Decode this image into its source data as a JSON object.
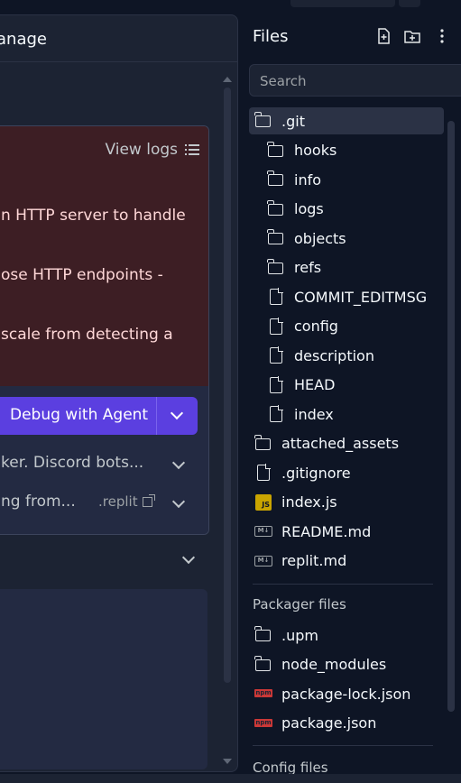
{
  "left_panel": {
    "title": "anage",
    "view_logs": "View logs",
    "error_lines": [
      "n HTTP server to handle",
      "ose HTTP endpoints -",
      "scale from detecting a"
    ],
    "debug_button": "Debug with Agent",
    "rows": [
      "ker. Discord bots...",
      "ng from..."
    ],
    "replit_link": ".replit"
  },
  "files_panel": {
    "title": "Files",
    "search_placeholder": "Search",
    "tree": [
      {
        "label": ".git",
        "type": "folder",
        "depth": 0,
        "selected": true
      },
      {
        "label": "hooks",
        "type": "folder",
        "depth": 1
      },
      {
        "label": "info",
        "type": "folder",
        "depth": 1
      },
      {
        "label": "logs",
        "type": "folder",
        "depth": 1
      },
      {
        "label": "objects",
        "type": "folder",
        "depth": 1
      },
      {
        "label": "refs",
        "type": "folder",
        "depth": 1
      },
      {
        "label": "COMMIT_EDITMSG",
        "type": "file",
        "depth": 1
      },
      {
        "label": "config",
        "type": "file",
        "depth": 1
      },
      {
        "label": "description",
        "type": "file",
        "depth": 1
      },
      {
        "label": "HEAD",
        "type": "file",
        "depth": 1
      },
      {
        "label": "index",
        "type": "file",
        "depth": 1
      },
      {
        "label": "attached_assets",
        "type": "folder",
        "depth": 0
      },
      {
        "label": ".gitignore",
        "type": "file",
        "depth": 0
      },
      {
        "label": "index.js",
        "type": "js",
        "depth": 0
      },
      {
        "label": "README.md",
        "type": "md",
        "depth": 0
      },
      {
        "label": "replit.md",
        "type": "md",
        "depth": 0
      }
    ],
    "packager_label": "Packager files",
    "packager": [
      {
        "label": ".upm",
        "type": "folder"
      },
      {
        "label": "node_modules",
        "type": "folder"
      },
      {
        "label": "package-lock.json",
        "type": "npm"
      },
      {
        "label": "package.json",
        "type": "npm"
      }
    ],
    "config_label": "Config files"
  },
  "icons": {
    "new_file": "new-file-icon",
    "new_folder": "new-folder-icon",
    "more": "more-vertical-icon",
    "js": "JS",
    "md": "M↓",
    "npm": "npm"
  },
  "colors": {
    "background": "#0e1525",
    "panel": "#1c2333",
    "accent": "#5b3fe0",
    "error_bg": "#3d1e24"
  }
}
